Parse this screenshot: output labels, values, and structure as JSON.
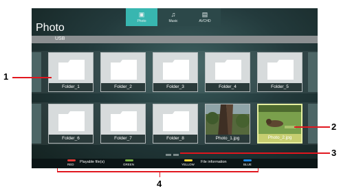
{
  "screen": {
    "title": "Photo",
    "tabs": [
      {
        "label": "Photo",
        "icon": "photo-icon",
        "glyph": "▣"
      },
      {
        "label": "Music",
        "icon": "music-note-icon",
        "glyph": "♫"
      },
      {
        "label": "AVCHD",
        "icon": "avchd-icon",
        "glyph": "▤"
      }
    ],
    "source": "USB",
    "items": [
      {
        "name": "Folder_1",
        "type": "folder"
      },
      {
        "name": "Folder_2",
        "type": "folder"
      },
      {
        "name": "Folder_3",
        "type": "folder"
      },
      {
        "name": "Folder_4",
        "type": "folder"
      },
      {
        "name": "Folder_5",
        "type": "folder"
      },
      {
        "name": "Folder_6",
        "type": "folder"
      },
      {
        "name": "Folder_7",
        "type": "folder"
      },
      {
        "name": "Folder_8",
        "type": "folder"
      },
      {
        "name": "Photo_1.jpg",
        "type": "photo"
      },
      {
        "name": "Photo_2.jpg",
        "type": "photo",
        "selected": true
      }
    ],
    "color_keys": [
      {
        "color": "RED",
        "hex": "#e53935",
        "desc": "Playable file(s)"
      },
      {
        "color": "GREEN",
        "hex": "#7cb342",
        "desc": ""
      },
      {
        "color": "YELLOW",
        "hex": "#fdd835",
        "desc": "File information"
      },
      {
        "color": "BLUE",
        "hex": "#1e88e5",
        "desc": ""
      }
    ]
  },
  "callouts": [
    "1",
    "2",
    "3",
    "4"
  ]
}
